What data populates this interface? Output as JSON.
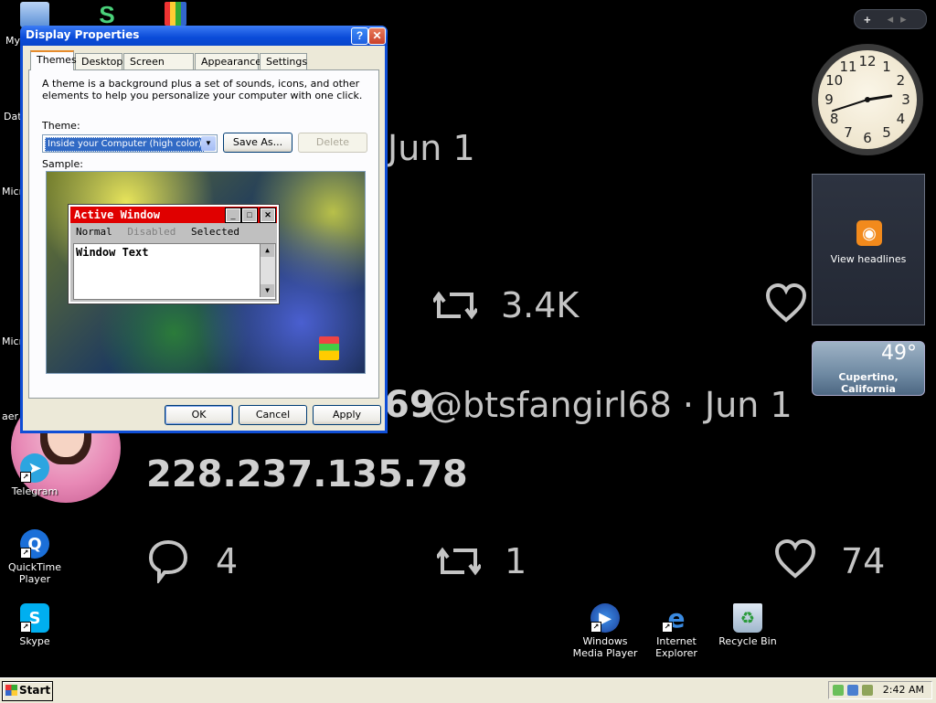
{
  "wallpaper": {
    "date1": "Jun 1",
    "retweet_count_1": "3.4K",
    "handle_line": "@btsfangirl68 · Jun 1",
    "handle_prefix": "69",
    "ip_text": "228.237.135.78",
    "reply_count_2": "4",
    "retweet_count_2": "1",
    "like_count_2": "74"
  },
  "desktop_icons": [
    {
      "label": "My",
      "icon": "computer-icon"
    },
    {
      "label": "Dat",
      "icon": "folder-icon"
    },
    {
      "label": "Micro",
      "icon": "app-icon"
    },
    {
      "label": "Micro\nB",
      "icon": "app-icon"
    },
    {
      "label": "aer",
      "icon": "app-icon"
    },
    {
      "label": "Telegram",
      "icon": "telegram-icon"
    },
    {
      "label": "QuickTime Player",
      "icon": "quicktime-icon"
    },
    {
      "label": "Skype",
      "icon": "skype-icon"
    },
    {
      "label": "Windows Media Player",
      "icon": "windows-media-player-icon"
    },
    {
      "label": "Internet Explorer",
      "icon": "internet-explorer-icon"
    },
    {
      "label": "Recycle Bin",
      "icon": "recycle-bin-icon"
    }
  ],
  "sidebar": {
    "controls": {
      "add": "+",
      "prev": "◂",
      "next": "▸"
    },
    "clock": {
      "numbers": [
        "12",
        "1",
        "2",
        "3",
        "4",
        "5",
        "6",
        "7",
        "8",
        "9",
        "10",
        "11"
      ],
      "hour": 2,
      "minute": 42
    },
    "feed": {
      "label": "View headlines",
      "icon": "rss-icon"
    },
    "weather": {
      "temperature": "49°",
      "location": "Cupertino, California"
    }
  },
  "dialog": {
    "title": "Display Properties",
    "help_button": "?",
    "close_button": "✕",
    "tabs": [
      "Themes",
      "Desktop",
      "Screen Saver",
      "Appearance",
      "Settings"
    ],
    "active_tab": "Themes",
    "description": "A theme is a background plus a set of sounds, icons, and other elements to help you personalize your computer with one click.",
    "theme_label": "Theme:",
    "theme_value": "Inside your Computer (high color)",
    "save_as": "Save As...",
    "delete": "Delete",
    "sample_label": "Sample:",
    "sample": {
      "window_title": "Active Window",
      "menu": {
        "normal": "Normal",
        "disabled": "Disabled",
        "selected": "Selected"
      },
      "window_text": "Window Text"
    },
    "ok": "OK",
    "cancel": "Cancel",
    "apply": "Apply"
  },
  "taskbar": {
    "start_label": "Start",
    "time": "2:42 AM"
  },
  "colors": {
    "xp_blue": "#0a4bd8",
    "dialog_bg": "#ece9d8",
    "sample_title_red": "#e00000",
    "selection_blue": "#316ac5"
  }
}
